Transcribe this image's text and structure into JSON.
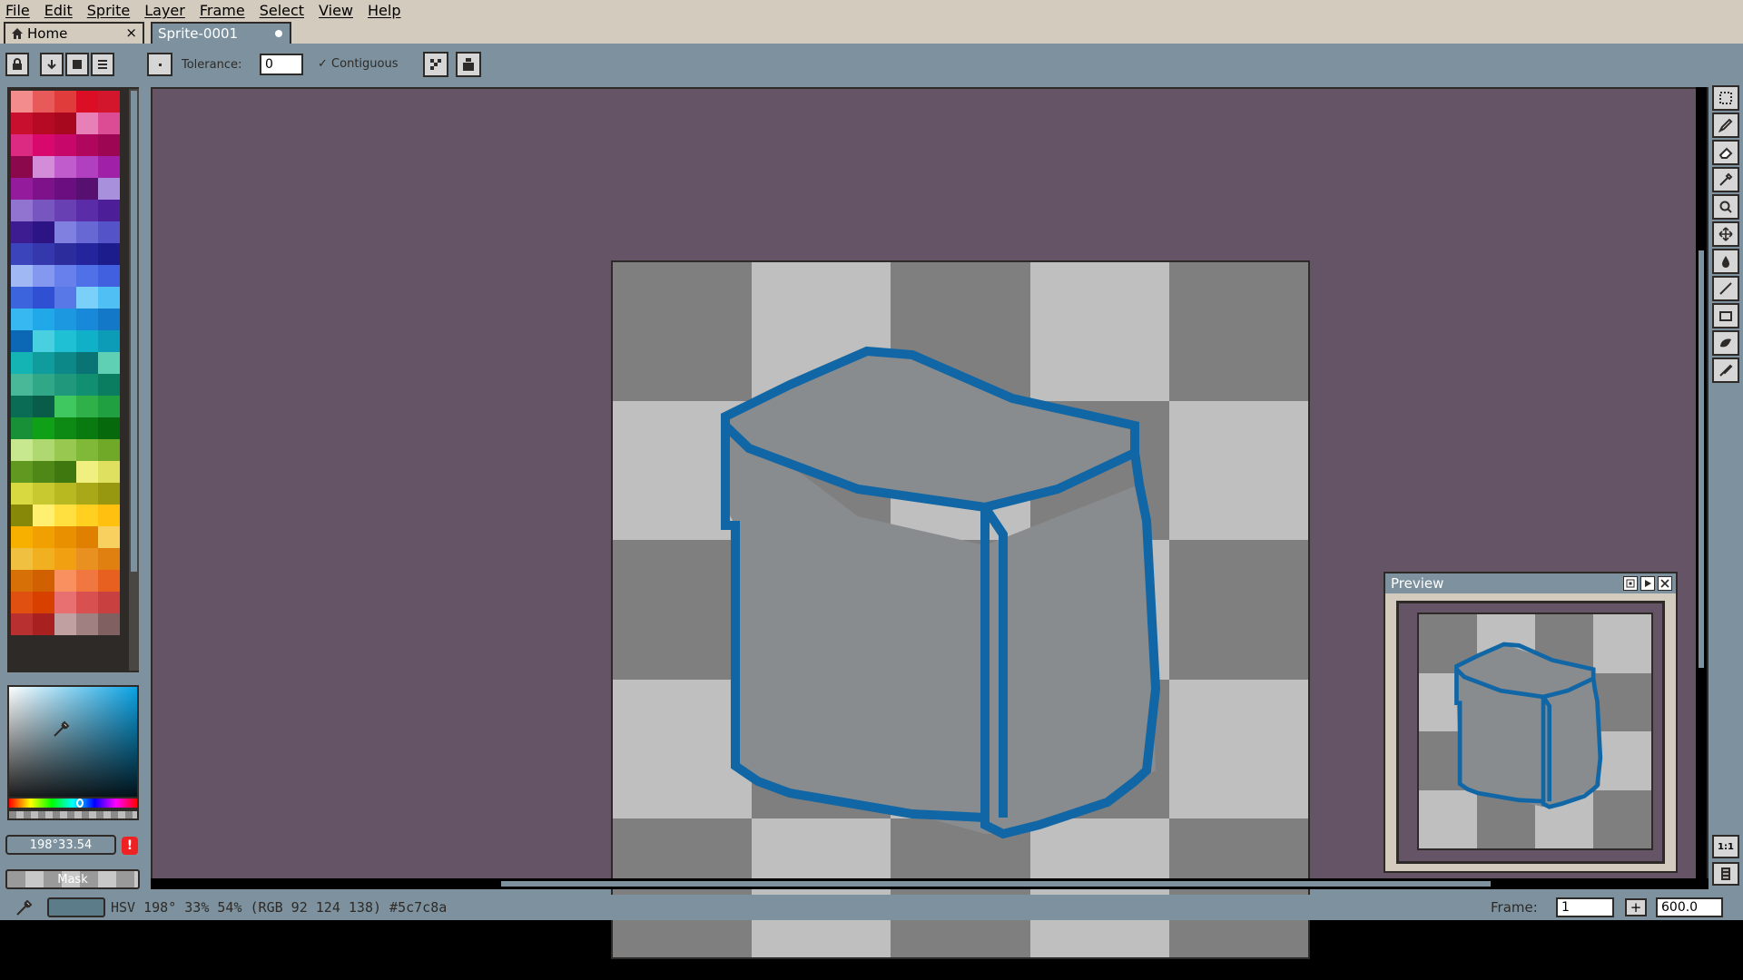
{
  "menu": [
    "File",
    "Edit",
    "Sprite",
    "Layer",
    "Frame",
    "Select",
    "View",
    "Help"
  ],
  "tabs": {
    "home": {
      "label": "Home",
      "close": "×"
    },
    "sprite": {
      "label": "Sprite-0001"
    }
  },
  "toolbar": {
    "tolerance_label": "Tolerance:",
    "tolerance_value": "0",
    "contiguous_label": "Contiguous",
    "contiguous_check": "✓"
  },
  "palette": [
    "#f38c8c",
    "#e85a5a",
    "#e13c3c",
    "#dc0e26",
    "#d4162c",
    "#c8102e",
    "#b60a23",
    "#a8081e",
    "#e880b8",
    "#dc4c94",
    "#dc2a82",
    "#d8086c",
    "#c8076a",
    "#b0065e",
    "#9c0652",
    "#8c084c",
    "#d28cd8",
    "#c05ccc",
    "#b040c0",
    "#a020a8",
    "#941c9c",
    "#7e128a",
    "#6a0e80",
    "#581070",
    "#a890dc",
    "#9074d0",
    "#7856c0",
    "#6840b4",
    "#5a2ca8",
    "#4c1e98",
    "#3c1c90",
    "#2c1484",
    "#8080e0",
    "#6868d4",
    "#5454c8",
    "#3c44bc",
    "#3438ac",
    "#2c2c9c",
    "#24249c",
    "#1c1c8c",
    "#a0b8f4",
    "#8498f0",
    "#6880ec",
    "#5070e8",
    "#4060e0",
    "#3c64dc",
    "#3050d4",
    "#5878e8",
    "#7ad0f8",
    "#50c0f4",
    "#38b8f0",
    "#20a8e8",
    "#1c98e0",
    "#1888d8",
    "#1478c8",
    "#0c68b4",
    "#48d0e0",
    "#20c0d4",
    "#10b0c8",
    "#0c9cb8",
    "#14b4b4",
    "#109c9c",
    "#0c8888",
    "#0a7474",
    "#60d0b4",
    "#48b898",
    "#30a888",
    "#20987c",
    "#109070",
    "#0a7c60",
    "#0a6c54",
    "#085c48",
    "#40c860",
    "#30b048",
    "#20a040",
    "#189038",
    "#10a018",
    "#0c8a14",
    "#087a10",
    "#066a0c",
    "#c8e890",
    "#b0d870",
    "#98c850",
    "#80b838",
    "#70a828",
    "#609820",
    "#508818",
    "#407810",
    "#f0f080",
    "#e0e060",
    "#d8d840",
    "#c8c830",
    "#b8b820",
    "#a8a818",
    "#989810",
    "#888808",
    "#fff070",
    "#ffe040",
    "#ffd020",
    "#ffc010",
    "#f8b000",
    "#f0a000",
    "#e89000",
    "#e08000",
    "#f8d060",
    "#f0c040",
    "#f0b020",
    "#f0a010",
    "#e89020",
    "#e08010",
    "#d87008",
    "#d06000",
    "#f89060",
    "#f07840",
    "#e86020",
    "#e05010",
    "#d84000",
    "#e87070",
    "#d85050",
    "#c84040",
    "#b83030",
    "#a82020",
    "#c0a0a0",
    "#a08080",
    "#806060"
  ],
  "color": {
    "hsv_field": "198°33.54",
    "warning": "!",
    "mask_label": "Mask"
  },
  "status": {
    "text": "HSV 198° 33% 54% (RGB 92 124 138) #5c7c8a",
    "swatch_color": "#5c7c8a",
    "frame_label": "Frame:",
    "frame_value": "1",
    "frame_add": "+",
    "zoom_value": "600.0"
  },
  "preview": {
    "title": "Preview"
  },
  "colors": {
    "workspace": "#7d929e",
    "canvas_bg": "#655366",
    "checker_dark": "#7f7f7f",
    "checker_light": "#bfbfbf",
    "cube_stroke": "#1166a6",
    "cube_fill": "#888c8e"
  }
}
